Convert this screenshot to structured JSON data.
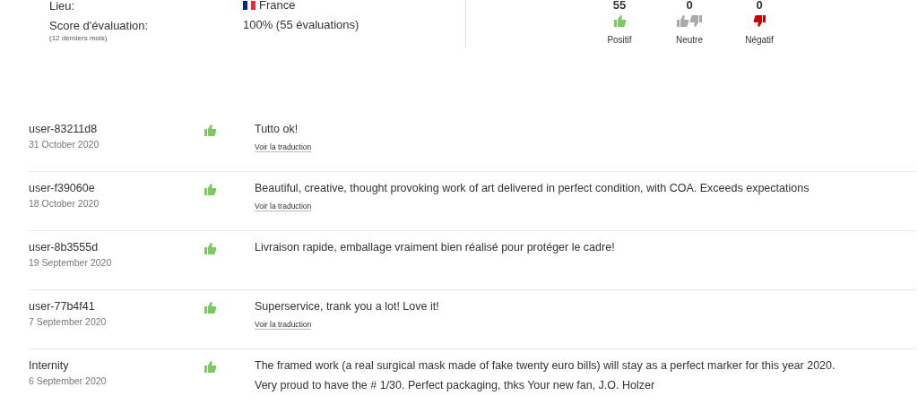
{
  "profile": {
    "fields": [
      {
        "label": "Lieu:",
        "value": "France",
        "flag": true
      },
      {
        "label": "Score d'évaluation:",
        "note": "(12 derniers mois)",
        "value": "100% (55 évaluations)",
        "flag": false
      }
    ]
  },
  "summary": [
    {
      "kind": "positive",
      "count": "55",
      "label": "Positif"
    },
    {
      "kind": "neutral",
      "count": "0",
      "label": "Neutre"
    },
    {
      "kind": "negative",
      "count": "0",
      "label": "Négatif"
    }
  ],
  "reviews": [
    {
      "user": "user-83211d8",
      "date": "31 October 2020",
      "kind": "positive",
      "lines": [
        "Tutto ok!"
      ],
      "link": "Voir la traduction"
    },
    {
      "user": "user-f39060e",
      "date": "18 October 2020",
      "kind": "positive",
      "lines": [
        "Beautiful, creative, thought provoking work of art delivered in perfect condition, with COA. Exceeds expectations"
      ],
      "link": "Voir la traduction"
    },
    {
      "user": "user-8b3555d",
      "date": "19 September 2020",
      "kind": "positive",
      "lines": [
        "Livraison rapide, emballage vraiment bien réalisé pour protéger le cadre!"
      ]
    },
    {
      "user": "user-77b4f41",
      "date": "7 September 2020",
      "kind": "positive",
      "lines": [
        "Superservice, trank you a lot! Love it!"
      ],
      "link": "Voir la traduction"
    },
    {
      "user": "Internity",
      "date": "6 September 2020",
      "kind": "positive",
      "lines": [
        "The framed work (a real surgical mask made of fake twenty euro bills) will stay as a perfect marker for this year 2020.",
        "Very proud to have the # 1/30. Perfect packaging, thks Your new fan, J.O. Holzer"
      ]
    }
  ]
}
